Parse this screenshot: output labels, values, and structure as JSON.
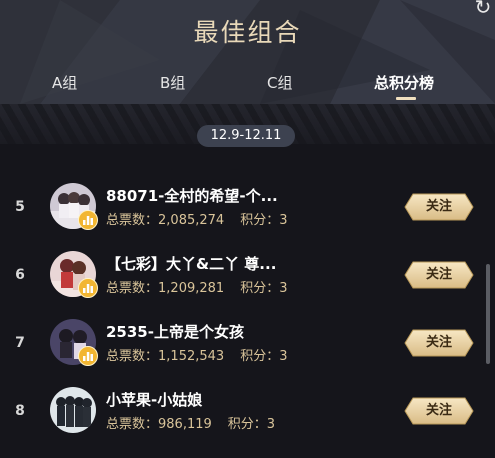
{
  "header": {
    "title": "最佳组合",
    "refresh_icon": "refresh-icon"
  },
  "tabs": [
    {
      "label": "A组",
      "active": false
    },
    {
      "label": "B组",
      "active": false
    },
    {
      "label": "C组",
      "active": false
    },
    {
      "label": "总积分榜",
      "active": true
    }
  ],
  "date_range": "12.9-12.11",
  "list": {
    "votes_label": "总票数：",
    "score_label": "积分：",
    "follow_label": "关注",
    "items": [
      {
        "rank": "5",
        "name": "88071-全村的希望-个...",
        "votes": "2,085,274",
        "score": "3"
      },
      {
        "rank": "6",
        "name": "【七彩】大丫&二丫 尊...",
        "votes": "1,209,281",
        "score": "3"
      },
      {
        "rank": "7",
        "name": "2535-上帝是个女孩",
        "votes": "1,152,543",
        "score": "3"
      },
      {
        "rank": "8",
        "name": "小苹果-小姑娘",
        "votes": "986,119",
        "score": "3"
      }
    ]
  },
  "colors": {
    "title": "#e9d9b9",
    "stats": "#d9c49a",
    "badge": "#f2b632",
    "follow_button": "#e9d3a6"
  }
}
